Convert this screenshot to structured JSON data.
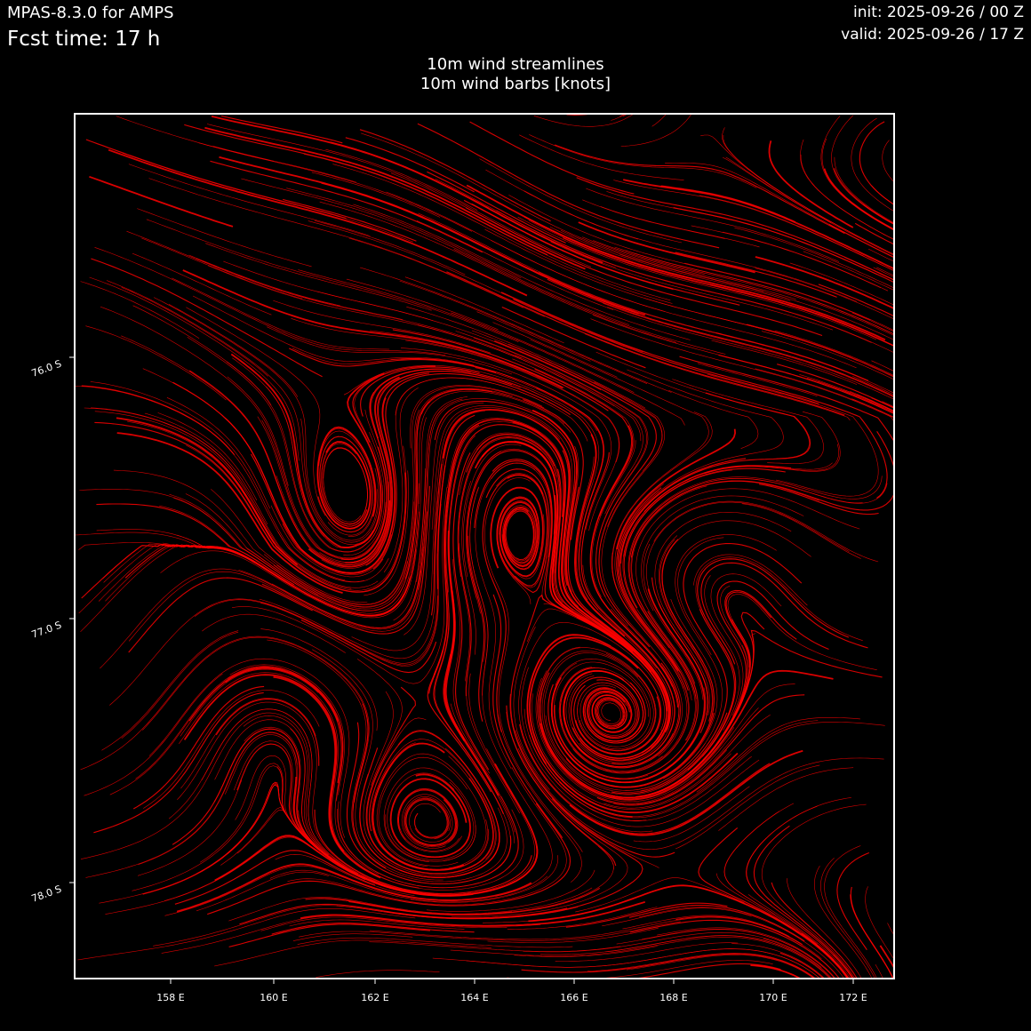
{
  "header": {
    "model": "MPAS-8.3.0 for AMPS",
    "fcst_time": "Fcst time:   17 h",
    "init": "init: 2025-09-26 / 00 Z",
    "valid": "valid: 2025-09-26 / 17 Z"
  },
  "titles": {
    "line1": "10m wind streamlines",
    "line2": "10m wind barbs [knots]"
  },
  "map": {
    "background_color": "#000000",
    "streamline_color": "#ff0000",
    "frame_color": "#ffffff",
    "lon_ticks": [
      "158 E",
      "160 E",
      "162 E",
      "164 E",
      "166 E",
      "168 E",
      "170 E",
      "172 E"
    ],
    "lat_ticks": [
      "76.0 S",
      "77.0 S",
      "78.0 S"
    ]
  }
}
